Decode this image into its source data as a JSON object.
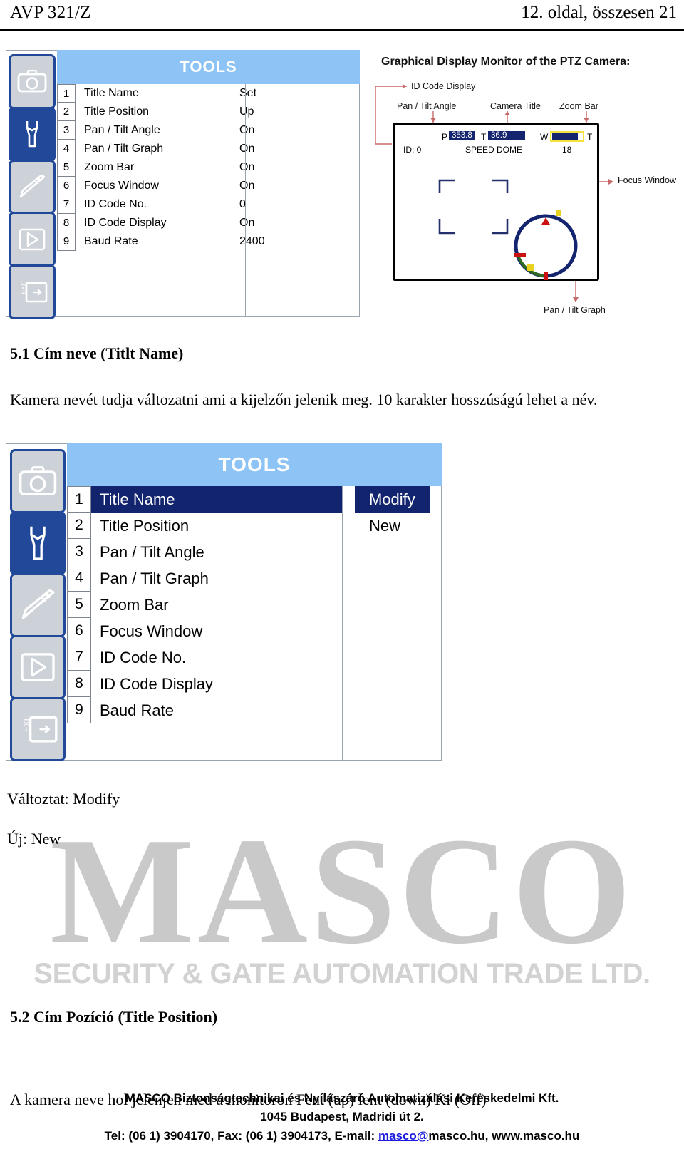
{
  "header": {
    "left": "AVP 321/Z",
    "right": "12. oldal, összesen 21"
  },
  "osd_menu_1": {
    "title": "TOOLS",
    "sidebar_icons": [
      "camera-icon",
      "wrench-icon",
      "pencil-icon",
      "play-icon",
      "exit-icon"
    ],
    "active_icon_index": 1,
    "rows": [
      {
        "no": "1",
        "label": "Title Name",
        "value": "Set"
      },
      {
        "no": "2",
        "label": "Title Position",
        "value": "Up"
      },
      {
        "no": "3",
        "label": "Pan / Tilt Angle",
        "value": "On"
      },
      {
        "no": "4",
        "label": "Pan / Tilt Graph",
        "value": "On"
      },
      {
        "no": "5",
        "label": "Zoom Bar",
        "value": "On"
      },
      {
        "no": "6",
        "label": "Focus Window",
        "value": "On"
      },
      {
        "no": "7",
        "label": "ID Code No.",
        "value": "0"
      },
      {
        "no": "8",
        "label": "ID Code Display",
        "value": "On"
      },
      {
        "no": "9",
        "label": "Baud Rate",
        "value": "2400"
      }
    ]
  },
  "diagram": {
    "title": "Graphical Display Monitor of the PTZ Camera:",
    "callouts": {
      "id_code_display": "ID Code Display",
      "pan_tilt_angle": "Pan / Tilt Angle",
      "camera_title": "Camera Title",
      "zoom_bar": "Zoom Bar",
      "focus_window": "Focus Window",
      "pan_tilt_graph": "Pan / Tilt Graph"
    },
    "monitor_osd": {
      "pan_letter": "P",
      "pan_value": "353.8",
      "tilt_letter": "T",
      "tilt_value": "36.9",
      "id_text": "ID: 0",
      "camera_title": "SPEED DOME",
      "zoom_wide": "W",
      "zoom_tele": "T",
      "zoom_value": "18"
    },
    "colors": {
      "chip_blue": "#14246e",
      "zoombar_border": "#f2e23a",
      "graph_circle": "#14246e",
      "graph_arc": "#2e6b1f",
      "graph_marker_red": "#cc1111",
      "graph_marker_yellow": "#e8d21f",
      "callout_line": "#c86a6a"
    }
  },
  "section_5_1": {
    "heading": "5.1 Cím neve (Titlt Name)",
    "body": "Kamera nevét tudja változatni ami a kijelzőn jelenik meg. 10 karakter hosszúságú lehet a név."
  },
  "osd_menu_2": {
    "title": "TOOLS",
    "sidebar_icons": [
      "camera-icon",
      "wrench-icon",
      "pencil-icon",
      "play-icon",
      "exit-icon"
    ],
    "active_icon_index": 1,
    "highlighted_row_index": 0,
    "rows": [
      {
        "no": "1",
        "label": "Title Name",
        "value": "Modify"
      },
      {
        "no": "2",
        "label": "Title Position",
        "value": "New"
      },
      {
        "no": "3",
        "label": "Pan / Tilt Angle",
        "value": ""
      },
      {
        "no": "4",
        "label": "Pan / Tilt Graph",
        "value": ""
      },
      {
        "no": "5",
        "label": "Zoom Bar",
        "value": ""
      },
      {
        "no": "6",
        "label": "Focus Window",
        "value": ""
      },
      {
        "no": "7",
        "label": "ID Code No.",
        "value": ""
      },
      {
        "no": "8",
        "label": "ID Code Display",
        "value": ""
      },
      {
        "no": "9",
        "label": "Baud Rate",
        "value": ""
      }
    ]
  },
  "legend": {
    "line1": "Változtat: Modify",
    "line2": "Új: New"
  },
  "watermark": {
    "main": "MASCO",
    "sub": "SECURITY & GATE AUTOMATION TRADE LTD."
  },
  "section_5_2": {
    "heading": "5.2 Cím Pozíció (Title Position)",
    "body": "A kamera neve hol jelenjen med a monitoron Fent (up) lent (down) Ki (Off)"
  },
  "footer": {
    "line1": "MASCO Biztonságtechnikai és Nyílászáró Automatizálási Kereskedelmi Kft.",
    "line2": "1045 Budapest, Madridi út 2.",
    "line3_a": "Tel: (06 1) 3904170, Fax: (06 1) 3904173, E-mail: ",
    "line3_link": "masco@",
    "line3_b": "masco.hu, www.masco.hu"
  }
}
